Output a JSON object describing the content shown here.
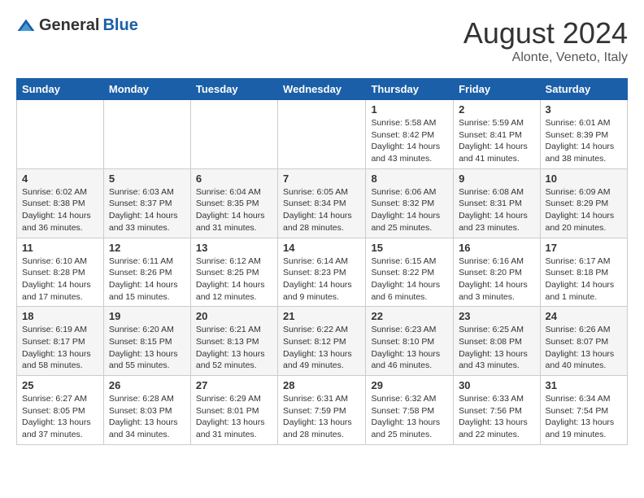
{
  "header": {
    "logo_general": "General",
    "logo_blue": "Blue",
    "month_title": "August 2024",
    "location": "Alonte, Veneto, Italy"
  },
  "weekdays": [
    "Sunday",
    "Monday",
    "Tuesday",
    "Wednesday",
    "Thursday",
    "Friday",
    "Saturday"
  ],
  "weeks": [
    [
      {
        "day": "",
        "info": ""
      },
      {
        "day": "",
        "info": ""
      },
      {
        "day": "",
        "info": ""
      },
      {
        "day": "",
        "info": ""
      },
      {
        "day": "1",
        "info": "Sunrise: 5:58 AM\nSunset: 8:42 PM\nDaylight: 14 hours\nand 43 minutes."
      },
      {
        "day": "2",
        "info": "Sunrise: 5:59 AM\nSunset: 8:41 PM\nDaylight: 14 hours\nand 41 minutes."
      },
      {
        "day": "3",
        "info": "Sunrise: 6:01 AM\nSunset: 8:39 PM\nDaylight: 14 hours\nand 38 minutes."
      }
    ],
    [
      {
        "day": "4",
        "info": "Sunrise: 6:02 AM\nSunset: 8:38 PM\nDaylight: 14 hours\nand 36 minutes."
      },
      {
        "day": "5",
        "info": "Sunrise: 6:03 AM\nSunset: 8:37 PM\nDaylight: 14 hours\nand 33 minutes."
      },
      {
        "day": "6",
        "info": "Sunrise: 6:04 AM\nSunset: 8:35 PM\nDaylight: 14 hours\nand 31 minutes."
      },
      {
        "day": "7",
        "info": "Sunrise: 6:05 AM\nSunset: 8:34 PM\nDaylight: 14 hours\nand 28 minutes."
      },
      {
        "day": "8",
        "info": "Sunrise: 6:06 AM\nSunset: 8:32 PM\nDaylight: 14 hours\nand 25 minutes."
      },
      {
        "day": "9",
        "info": "Sunrise: 6:08 AM\nSunset: 8:31 PM\nDaylight: 14 hours\nand 23 minutes."
      },
      {
        "day": "10",
        "info": "Sunrise: 6:09 AM\nSunset: 8:29 PM\nDaylight: 14 hours\nand 20 minutes."
      }
    ],
    [
      {
        "day": "11",
        "info": "Sunrise: 6:10 AM\nSunset: 8:28 PM\nDaylight: 14 hours\nand 17 minutes."
      },
      {
        "day": "12",
        "info": "Sunrise: 6:11 AM\nSunset: 8:26 PM\nDaylight: 14 hours\nand 15 minutes."
      },
      {
        "day": "13",
        "info": "Sunrise: 6:12 AM\nSunset: 8:25 PM\nDaylight: 14 hours\nand 12 minutes."
      },
      {
        "day": "14",
        "info": "Sunrise: 6:14 AM\nSunset: 8:23 PM\nDaylight: 14 hours\nand 9 minutes."
      },
      {
        "day": "15",
        "info": "Sunrise: 6:15 AM\nSunset: 8:22 PM\nDaylight: 14 hours\nand 6 minutes."
      },
      {
        "day": "16",
        "info": "Sunrise: 6:16 AM\nSunset: 8:20 PM\nDaylight: 14 hours\nand 3 minutes."
      },
      {
        "day": "17",
        "info": "Sunrise: 6:17 AM\nSunset: 8:18 PM\nDaylight: 14 hours\nand 1 minute."
      }
    ],
    [
      {
        "day": "18",
        "info": "Sunrise: 6:19 AM\nSunset: 8:17 PM\nDaylight: 13 hours\nand 58 minutes."
      },
      {
        "day": "19",
        "info": "Sunrise: 6:20 AM\nSunset: 8:15 PM\nDaylight: 13 hours\nand 55 minutes."
      },
      {
        "day": "20",
        "info": "Sunrise: 6:21 AM\nSunset: 8:13 PM\nDaylight: 13 hours\nand 52 minutes."
      },
      {
        "day": "21",
        "info": "Sunrise: 6:22 AM\nSunset: 8:12 PM\nDaylight: 13 hours\nand 49 minutes."
      },
      {
        "day": "22",
        "info": "Sunrise: 6:23 AM\nSunset: 8:10 PM\nDaylight: 13 hours\nand 46 minutes."
      },
      {
        "day": "23",
        "info": "Sunrise: 6:25 AM\nSunset: 8:08 PM\nDaylight: 13 hours\nand 43 minutes."
      },
      {
        "day": "24",
        "info": "Sunrise: 6:26 AM\nSunset: 8:07 PM\nDaylight: 13 hours\nand 40 minutes."
      }
    ],
    [
      {
        "day": "25",
        "info": "Sunrise: 6:27 AM\nSunset: 8:05 PM\nDaylight: 13 hours\nand 37 minutes."
      },
      {
        "day": "26",
        "info": "Sunrise: 6:28 AM\nSunset: 8:03 PM\nDaylight: 13 hours\nand 34 minutes."
      },
      {
        "day": "27",
        "info": "Sunrise: 6:29 AM\nSunset: 8:01 PM\nDaylight: 13 hours\nand 31 minutes."
      },
      {
        "day": "28",
        "info": "Sunrise: 6:31 AM\nSunset: 7:59 PM\nDaylight: 13 hours\nand 28 minutes."
      },
      {
        "day": "29",
        "info": "Sunrise: 6:32 AM\nSunset: 7:58 PM\nDaylight: 13 hours\nand 25 minutes."
      },
      {
        "day": "30",
        "info": "Sunrise: 6:33 AM\nSunset: 7:56 PM\nDaylight: 13 hours\nand 22 minutes."
      },
      {
        "day": "31",
        "info": "Sunrise: 6:34 AM\nSunset: 7:54 PM\nDaylight: 13 hours\nand 19 minutes."
      }
    ]
  ]
}
